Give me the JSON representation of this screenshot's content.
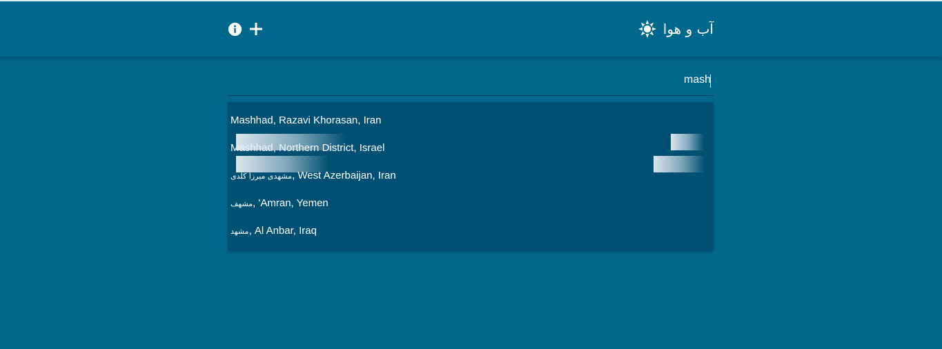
{
  "header": {
    "title": "آب و هوا",
    "icons": {
      "brand": "sun-icon",
      "info": "info-icon",
      "add": "plus-icon"
    }
  },
  "search": {
    "value": "mash"
  },
  "suggestions": [
    {
      "fa": "",
      "label": "Mashhad, Razavi Khorasan, Iran"
    },
    {
      "fa": "",
      "label": "Mashhad, Northern District, Israel"
    },
    {
      "fa": "مشهدی میرزا کلدی",
      "label": ", West Azerbaijan, Iran"
    },
    {
      "fa": "مشهف",
      "label": ", 'Amran, Yemen"
    },
    {
      "fa": "مشهد",
      "label": ", Al Anbar, Iraq"
    }
  ],
  "colors": {
    "background": "#00668a",
    "header": "#00688c",
    "dropdown": "#005073",
    "text": "#ffffff"
  }
}
